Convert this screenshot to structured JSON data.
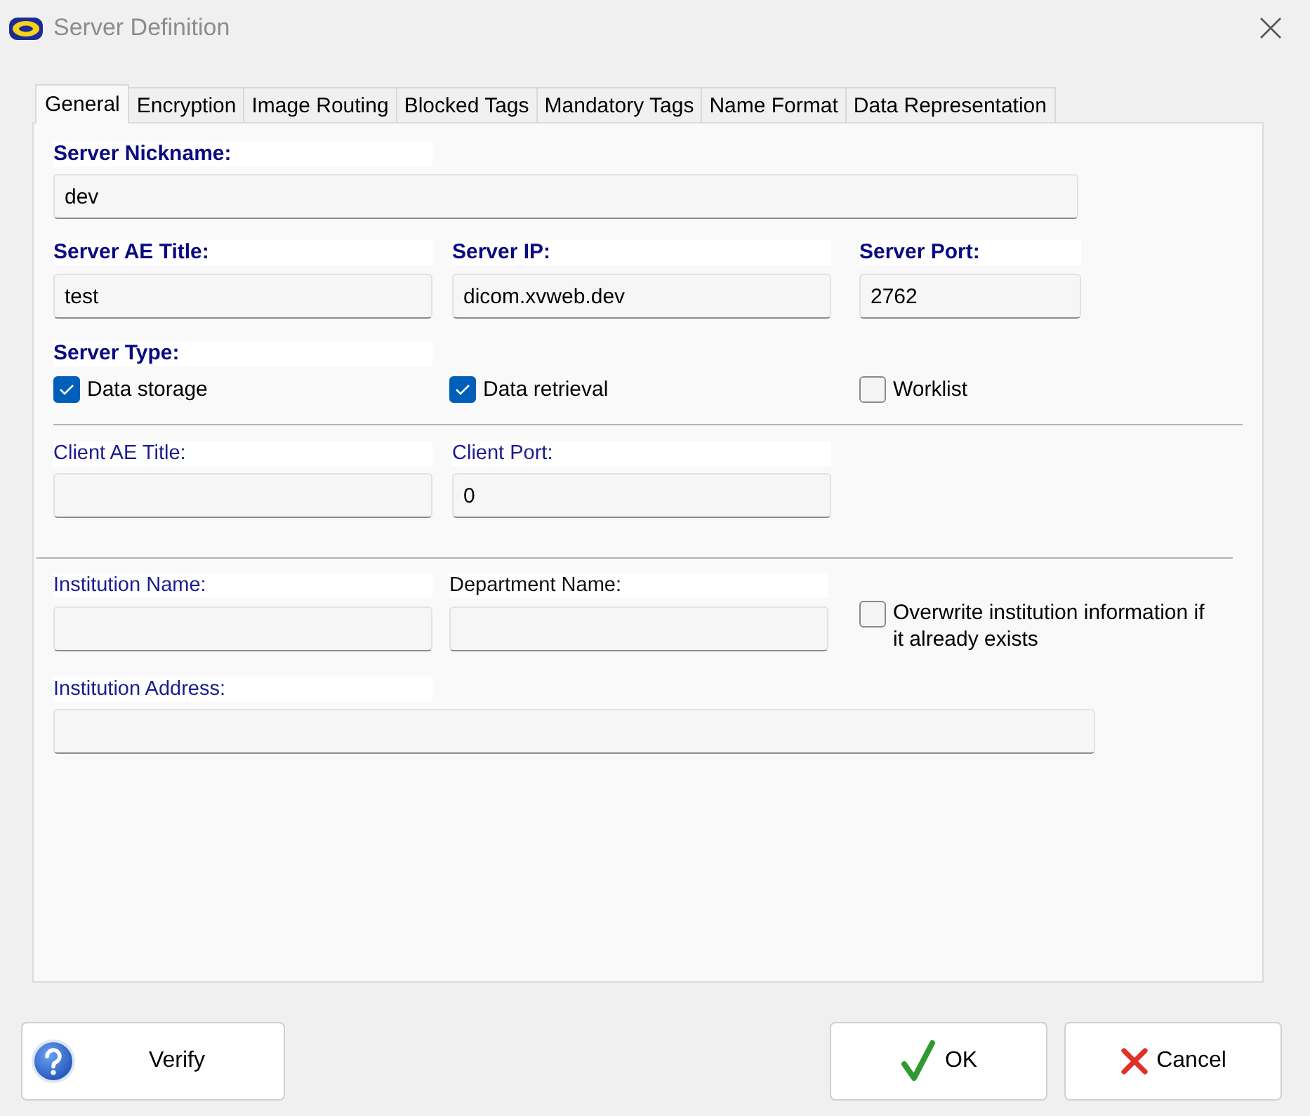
{
  "window": {
    "title": "Server Definition"
  },
  "tabs": [
    {
      "label": "General",
      "selected": true
    },
    {
      "label": "Encryption",
      "selected": false
    },
    {
      "label": "Image Routing",
      "selected": false
    },
    {
      "label": "Blocked Tags",
      "selected": false
    },
    {
      "label": "Mandatory Tags",
      "selected": false
    },
    {
      "label": "Name Format",
      "selected": false
    },
    {
      "label": "Data Representation",
      "selected": false
    }
  ],
  "server": {
    "nickname": {
      "label": "Server Nickname:",
      "value": "dev"
    },
    "ae_title": {
      "label": "Server AE Title:",
      "value": "test"
    },
    "ip": {
      "label": "Server IP:",
      "value": "dicom.xvweb.dev"
    },
    "port": {
      "label": "Server Port:",
      "value": "2762"
    },
    "type": {
      "label": "Server Type:",
      "options": [
        {
          "label": "Data storage",
          "checked": true
        },
        {
          "label": "Data retrieval",
          "checked": true
        },
        {
          "label": "Worklist",
          "checked": false
        }
      ]
    }
  },
  "client": {
    "ae_title": {
      "label": "Client AE Title:"
    },
    "port": {
      "label": "Client Port:",
      "value": "0"
    }
  },
  "institution": {
    "name": {
      "label": "Institution Name:"
    },
    "department_name": {
      "label": "Department Name:"
    },
    "overwrite_existing": {
      "label": "Overwrite institution information if it already exists",
      "checked": false
    },
    "address": {
      "label": "Institution Address:"
    }
  },
  "buttons": [
    {
      "kind": "verify",
      "label": "Verify"
    },
    {
      "kind": "ok",
      "label": "OK"
    },
    {
      "kind": "cancel",
      "label": "Cancel"
    }
  ]
}
